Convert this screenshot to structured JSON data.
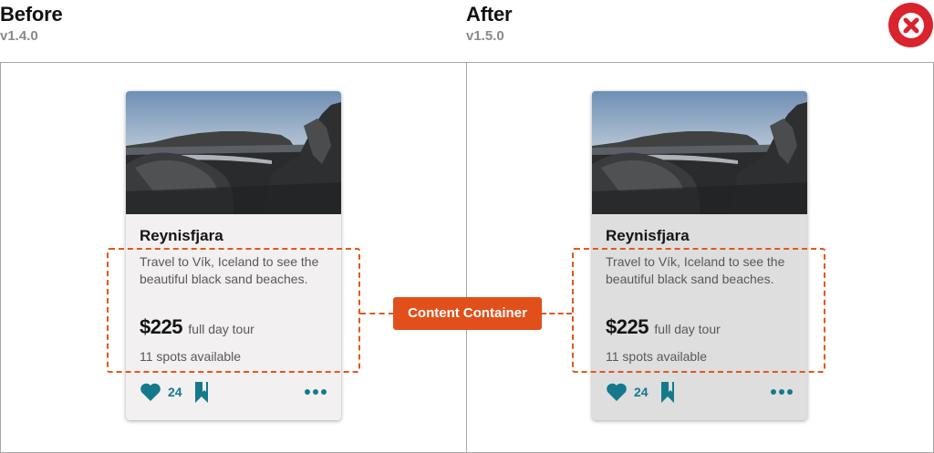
{
  "before": {
    "heading": "Before",
    "version": "v1.4.0"
  },
  "after": {
    "heading": "After",
    "version": "v1.5.0"
  },
  "comparison_status": "fail",
  "card": {
    "title": "Reynisfjara",
    "description": "Travel to Vík, Iceland to see the beautiful black sand beaches.",
    "price": "$225",
    "price_unit": "full day tour",
    "availability": "11 spots available",
    "like_count": "24",
    "actions": [
      "heart-icon",
      "bookmark-icon",
      "more-icon"
    ]
  },
  "annotation": {
    "label": "Content Container"
  },
  "colors": {
    "accent": "#137a8c",
    "annotation": "#e1581b",
    "fail": "#d9232d",
    "card_before": "#f2f0f0",
    "card_after": "#dedede"
  }
}
